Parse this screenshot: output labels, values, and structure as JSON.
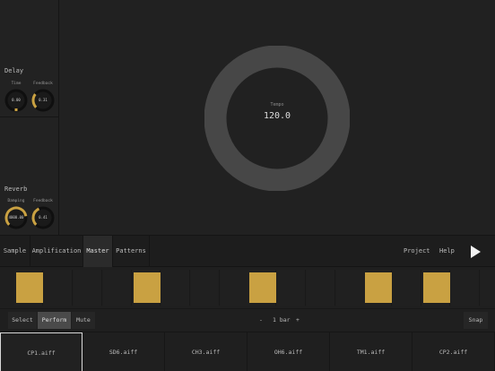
{
  "effects": {
    "delay": {
      "title": "Delay",
      "knobs": [
        {
          "label": "Time",
          "value": "0.00",
          "level": 0.0
        },
        {
          "label": "Feedback",
          "value": "0.31",
          "level": 0.31
        }
      ]
    },
    "reverb": {
      "title": "Reverb",
      "knobs": [
        {
          "label": "Damping",
          "value": "4000.00",
          "level": 0.8
        },
        {
          "label": "Feedback",
          "value": "0.41",
          "level": 0.41
        }
      ]
    }
  },
  "tempo": {
    "label": "Tempo",
    "value": "120.0"
  },
  "tabs": [
    {
      "label": "Sample",
      "active": false
    },
    {
      "label": "Amplification",
      "active": false
    },
    {
      "label": "Master",
      "active": true
    },
    {
      "label": "Patterns",
      "active": false
    }
  ],
  "header_right": {
    "project_label": "Project",
    "help_label": "Help"
  },
  "steps": [
    true,
    false,
    false,
    false,
    true,
    false,
    false,
    false,
    true,
    false,
    false,
    false,
    true,
    false,
    true,
    false,
    false
  ],
  "modes": [
    {
      "label": "Select",
      "active": false
    },
    {
      "label": "Perform",
      "active": true
    },
    {
      "label": "Mute",
      "active": false
    }
  ],
  "bar_control": {
    "decrement": "-",
    "value": "1 bar",
    "increment": "+"
  },
  "snap_label": "Snap",
  "samples": [
    "CP1.aiff",
    "SD6.aiff",
    "CH3.aiff",
    "OH6.aiff",
    "TM1.aiff",
    "CP2.aiff"
  ],
  "selected_sample_index": 0,
  "colors": {
    "accent": "#c9a142",
    "ring": "#474747",
    "knob_track": "#0f0f0f"
  }
}
